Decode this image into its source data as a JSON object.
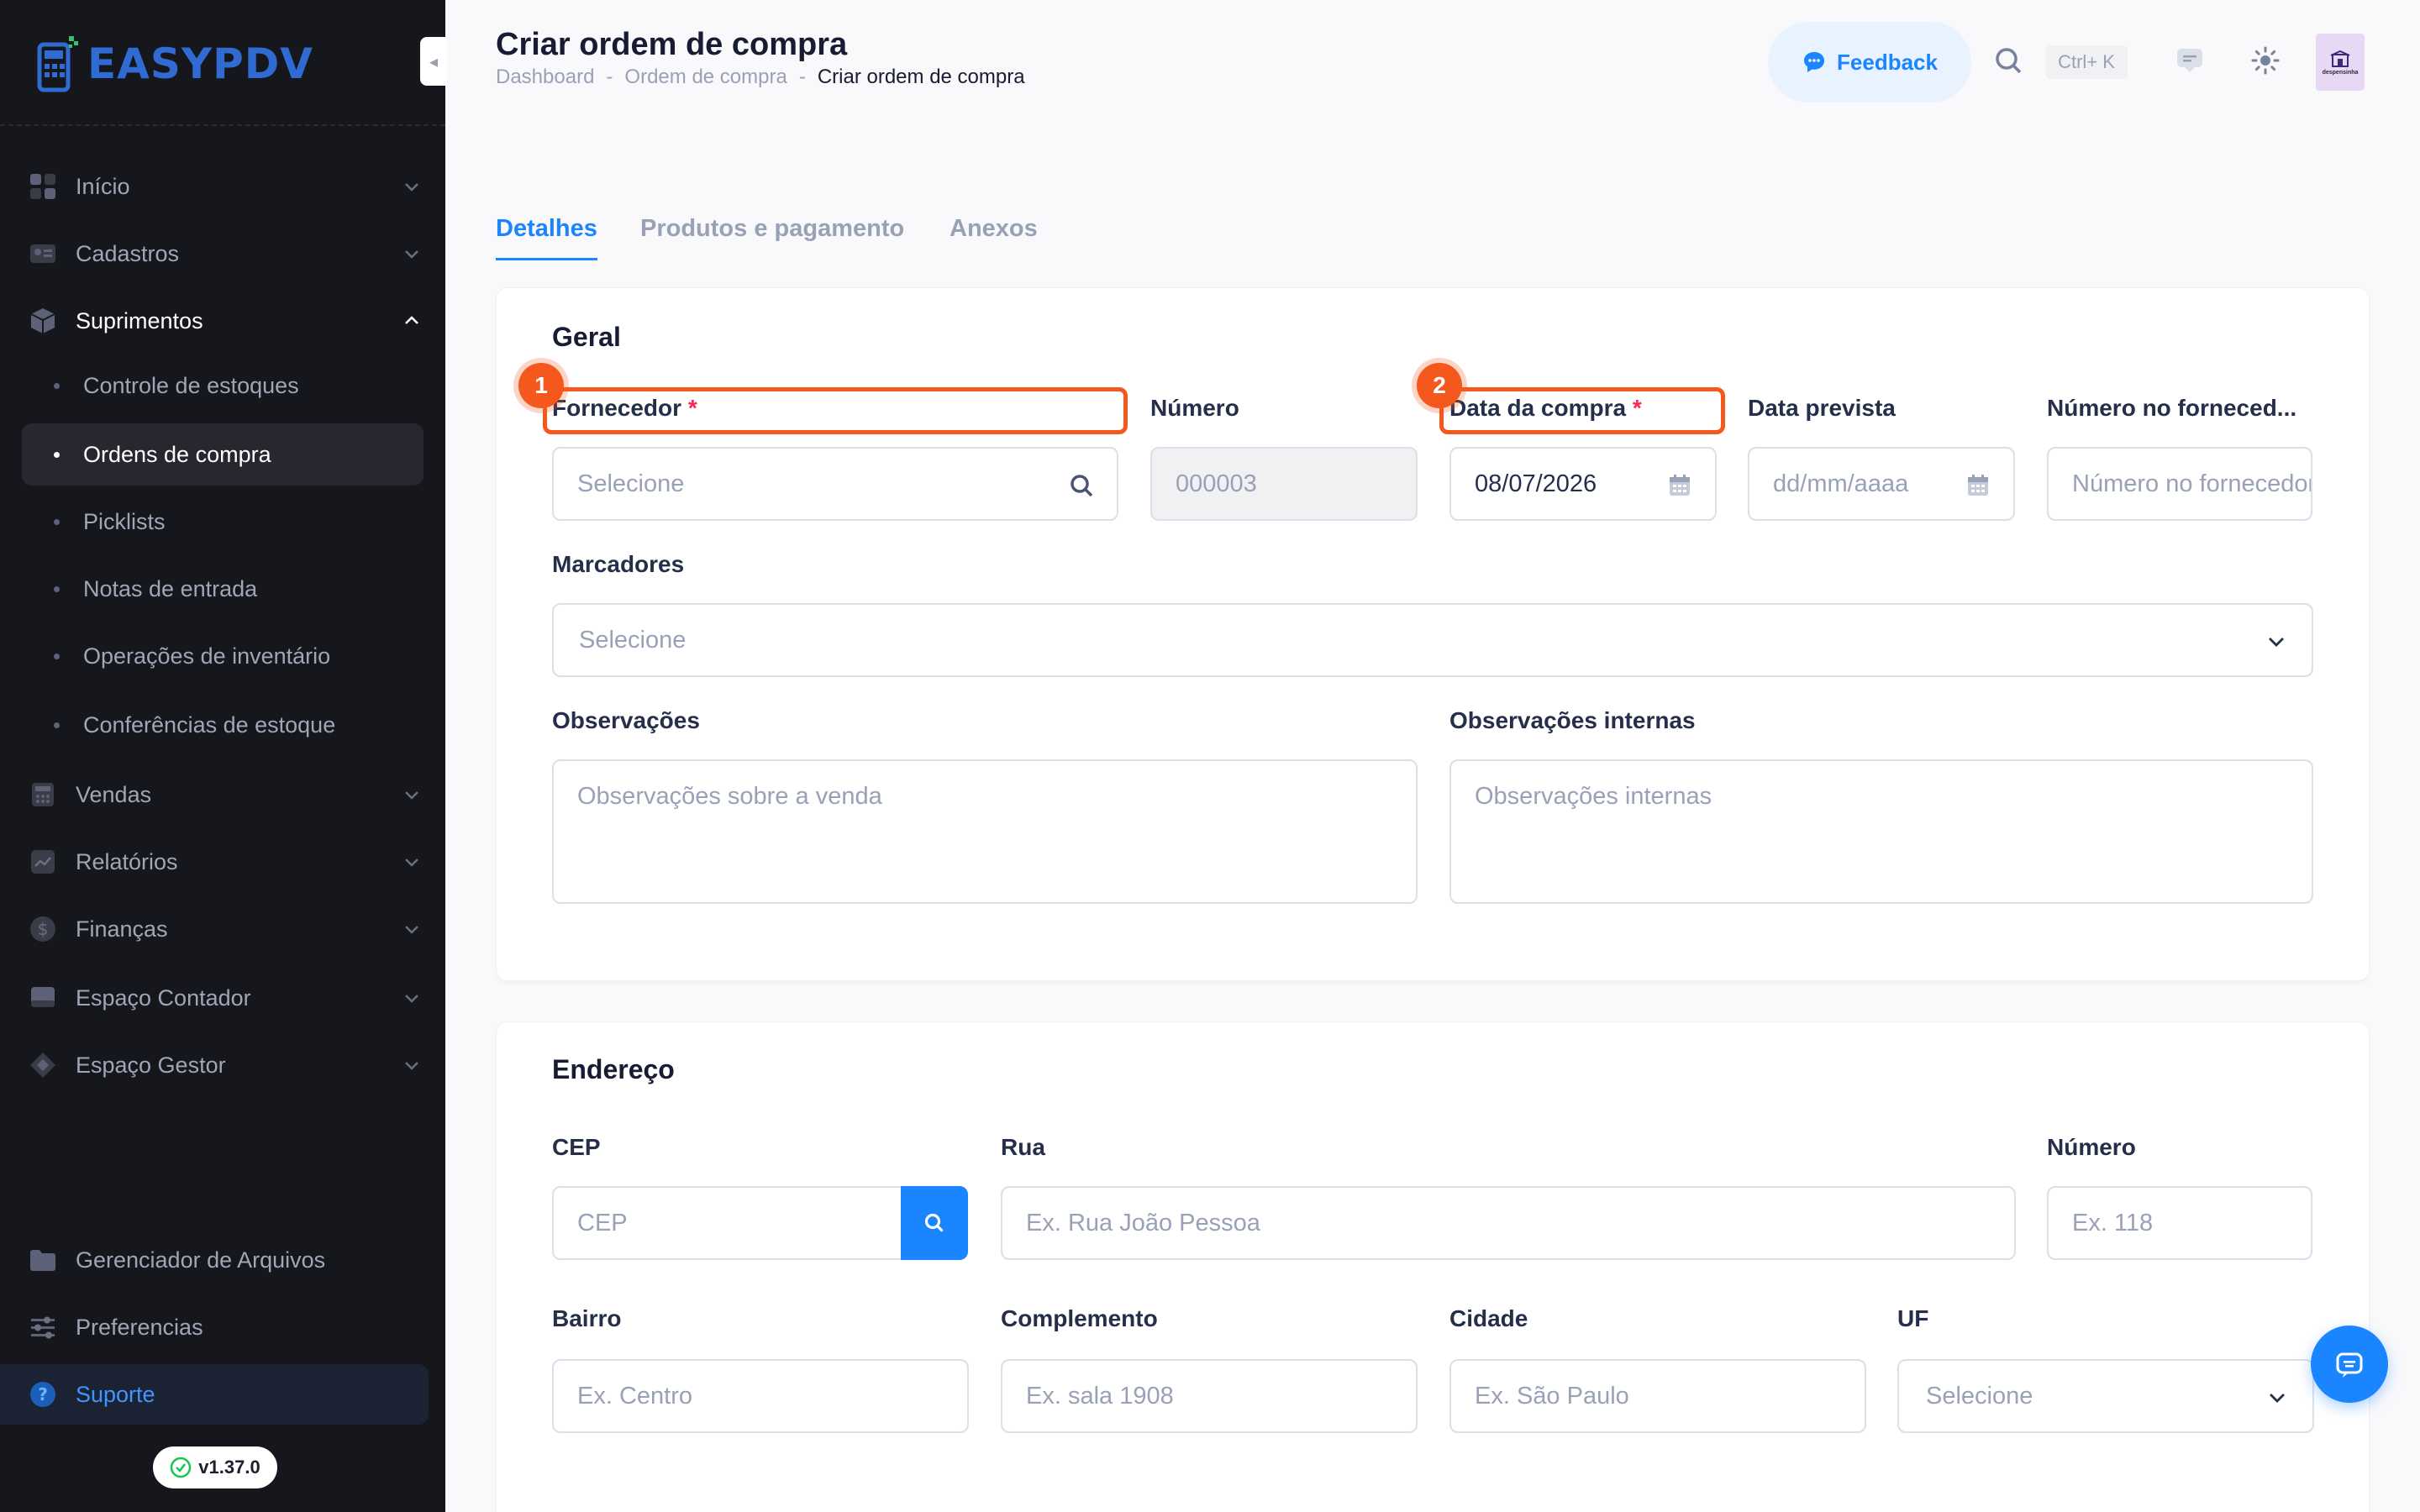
{
  "brand": {
    "logo_text": "EASYPDV",
    "accent": "#1b84ff",
    "highlight": "#f4581c"
  },
  "sidebar": {
    "items": [
      {
        "label": "Início",
        "icon": "grid-icon"
      },
      {
        "label": "Cadastros",
        "icon": "id-card-icon"
      },
      {
        "label": "Suprimentos",
        "icon": "package-icon"
      },
      {
        "label": "Vendas",
        "icon": "calculator-icon"
      },
      {
        "label": "Relatórios",
        "icon": "chart-icon"
      },
      {
        "label": "Finanças",
        "icon": "dollar-icon"
      },
      {
        "label": "Espaço Contador",
        "icon": "monitor-icon"
      },
      {
        "label": "Espaço Gestor",
        "icon": "diamond-icon"
      }
    ],
    "sub_items": [
      {
        "label": "Controle de estoques"
      },
      {
        "label": "Ordens de compra"
      },
      {
        "label": "Picklists"
      },
      {
        "label": "Notas de entrada"
      },
      {
        "label": "Operações de inventário"
      },
      {
        "label": "Conferências de estoque"
      }
    ],
    "bottom": [
      {
        "label": "Gerenciador de Arquivos",
        "icon": "folder-icon"
      },
      {
        "label": "Preferencias",
        "icon": "sliders-icon"
      },
      {
        "label": "Suporte",
        "icon": "help-icon"
      }
    ],
    "version": "v1.37.0"
  },
  "header": {
    "title": "Criar ordem de compra",
    "breadcrumb": [
      "Dashboard",
      "-",
      "Ordem de compra",
      "-",
      "Criar ordem de compra"
    ],
    "feedback_label": "Feedback",
    "shortcut": "Ctrl+ K",
    "avatar_text": "despensinha"
  },
  "tabs": [
    "Detalhes",
    "Produtos e pagamento",
    "Anexos"
  ],
  "geral": {
    "title": "Geral",
    "fornecedor": {
      "label": "Fornecedor",
      "required": "*",
      "placeholder": "Selecione"
    },
    "numero": {
      "label": "Número",
      "value": "000003"
    },
    "data_compra": {
      "label": "Data da compra",
      "required": "*",
      "value": "08/07/2026"
    },
    "data_prevista": {
      "label": "Data prevista",
      "placeholder": "dd/mm/aaaa"
    },
    "numero_fornecedor": {
      "label": "Número no forneced...",
      "placeholder": "Número no fornecedor"
    },
    "marcadores": {
      "label": "Marcadores",
      "placeholder": "Selecione"
    },
    "observacoes": {
      "label": "Observações",
      "placeholder": "Observações sobre a venda"
    },
    "observacoes_internas": {
      "label": "Observações internas",
      "placeholder": "Observações internas"
    },
    "badges": [
      "1",
      "2"
    ]
  },
  "endereco": {
    "title": "Endereço",
    "cep": {
      "label": "CEP",
      "placeholder": "CEP"
    },
    "rua": {
      "label": "Rua",
      "placeholder": "Ex. Rua João Pessoa"
    },
    "numero": {
      "label": "Número",
      "placeholder": "Ex. 118"
    },
    "bairro": {
      "label": "Bairro",
      "placeholder": "Ex. Centro"
    },
    "complemento": {
      "label": "Complemento",
      "placeholder": "Ex. sala 1908"
    },
    "cidade": {
      "label": "Cidade",
      "placeholder": "Ex. São Paulo"
    },
    "uf": {
      "label": "UF",
      "placeholder": "Selecione"
    }
  }
}
